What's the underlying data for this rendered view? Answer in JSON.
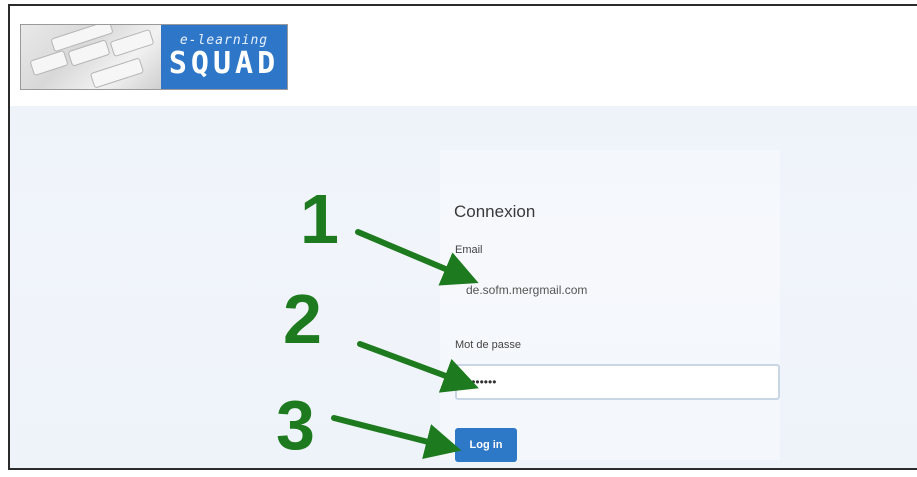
{
  "logo": {
    "subtitle": "e-learning",
    "brand": "SQUAD"
  },
  "form": {
    "title": "Connexion",
    "email_label": "Email",
    "email_value": "de.sofm.mergmail.com",
    "password_label": "Mot de passe",
    "password_value": "•••••••",
    "login_label": "Log in"
  },
  "annotations": {
    "step1": "1",
    "step2": "2",
    "step3": "3",
    "arrow_color": "#1e7a1e"
  },
  "colors": {
    "brand_blue": "#2e77c8",
    "button_blue": "#2e78c8",
    "page_bg": "#eef3fa"
  }
}
